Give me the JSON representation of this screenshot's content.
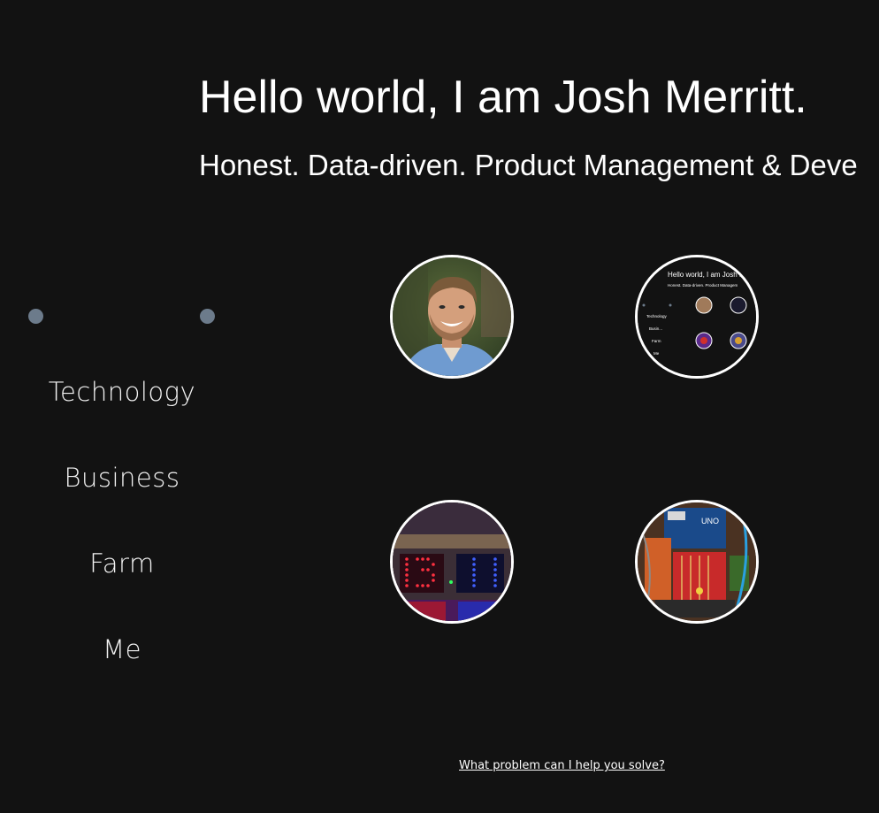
{
  "header": {
    "title": "Hello world, I am Josh Merritt.",
    "tagline": "Honest. Data-driven. Product Management & Deve"
  },
  "carousel": {
    "prev_icon": "dot-icon",
    "next_icon": "dot-icon"
  },
  "nav": {
    "items": [
      {
        "label": "Technology"
      },
      {
        "label": "Business"
      },
      {
        "label": "Farm"
      },
      {
        "label": "Me"
      }
    ]
  },
  "gallery": {
    "tiles": [
      {
        "subject": "portrait-photo"
      },
      {
        "subject": "site-screenshot-thumbnail",
        "mini_title": "Hello world, I am Josh M",
        "mini_tagline": "Honest. Data-driven. Product Managem",
        "mini_nav": [
          "Technology",
          "Busin...",
          "Farm",
          "Me"
        ]
      },
      {
        "subject": "led-clock-photo"
      },
      {
        "subject": "circuit-board-photo"
      }
    ]
  },
  "footer": {
    "cta_label": "What problem can I help you solve?"
  },
  "colors": {
    "background": "#121212",
    "text": "#ffffff",
    "dot": "#6c7b8b",
    "tile_border": "#ffffff"
  }
}
